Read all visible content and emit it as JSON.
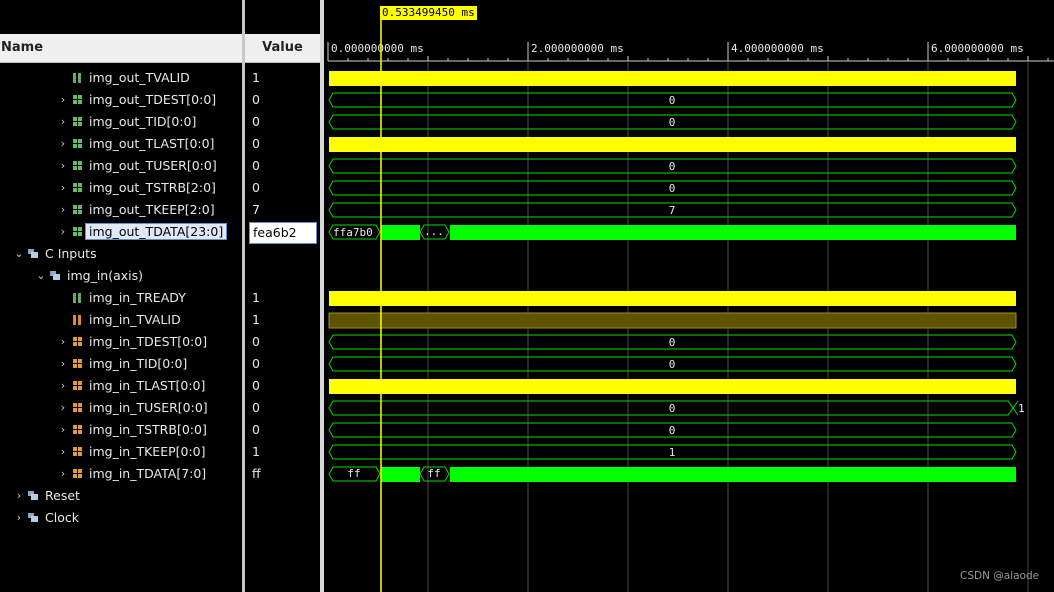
{
  "header": {
    "name_col": "Name",
    "value_col": "Value"
  },
  "cursor": {
    "time_label": "0.533499450 ms"
  },
  "time_ruler": {
    "ticks": [
      "0.000000000 ms",
      "2.000000000 ms",
      "4.000000000 ms",
      "6.000000000 ms"
    ]
  },
  "rows": [
    {
      "name": "img_out_TVALID",
      "value": "1"
    },
    {
      "name": "img_out_TDEST[0:0]",
      "value": "0",
      "bus": "0"
    },
    {
      "name": "img_out_TID[0:0]",
      "value": "0",
      "bus": "0"
    },
    {
      "name": "img_out_TLAST[0:0]",
      "value": "0"
    },
    {
      "name": "img_out_TUSER[0:0]",
      "value": "0",
      "bus": "0"
    },
    {
      "name": "img_out_TSTRB[2:0]",
      "value": "0",
      "bus": "0"
    },
    {
      "name": "img_out_TKEEP[2:0]",
      "value": "7",
      "bus": "7"
    },
    {
      "name": "img_out_TDATA[23:0]",
      "value": "fea6b2",
      "seg1": "ffa7b0",
      "seg2": "..."
    },
    {
      "name": "C Inputs"
    },
    {
      "name": "img_in(axis)"
    },
    {
      "name": "img_in_TREADY",
      "value": "1"
    },
    {
      "name": "img_in_TVALID",
      "value": "1"
    },
    {
      "name": "img_in_TDEST[0:0]",
      "value": "0",
      "bus": "0"
    },
    {
      "name": "img_in_TID[0:0]",
      "value": "0",
      "bus": "0"
    },
    {
      "name": "img_in_TLAST[0:0]",
      "value": "0"
    },
    {
      "name": "img_in_TUSER[0:0]",
      "value": "0",
      "bus": "0",
      "end": "1"
    },
    {
      "name": "img_in_TSTRB[0:0]",
      "value": "0",
      "bus": "0"
    },
    {
      "name": "img_in_TKEEP[0:0]",
      "value": "1",
      "bus": "1"
    },
    {
      "name": "img_in_TDATA[7:0]",
      "value": "ff",
      "seg1": "ff",
      "seg2": "ff"
    },
    {
      "name": "Reset"
    },
    {
      "name": "Clock"
    }
  ],
  "watermark": "CSDN @alaode",
  "colors": {
    "high": "#ffff00",
    "bus": "#00ff00",
    "dim_high": "#5c5400",
    "cursor": "#ffff00"
  }
}
